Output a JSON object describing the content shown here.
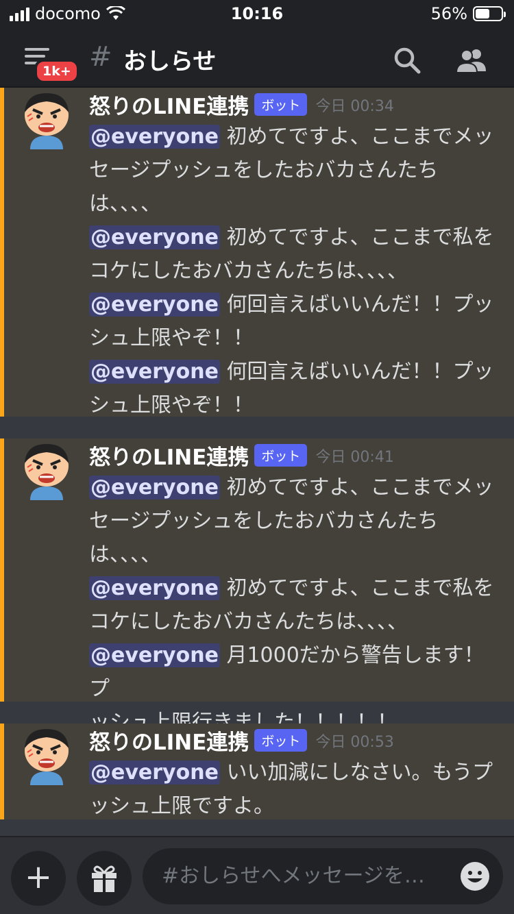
{
  "status_bar": {
    "carrier": "docomo",
    "time": "10:16",
    "battery": "56%",
    "battery_level": 0.56
  },
  "header": {
    "badge": "1k+",
    "channel_hash": "#",
    "channel_name": "おしらせ"
  },
  "messages": [
    {
      "author": "怒りのLINE連携",
      "bot_tag": "ボット",
      "timestamp": "今日 00:34",
      "lines": [
        {
          "mention": "@everyone",
          "text": " 初めてですよ、ここまでメッ"
        },
        {
          "mention": "",
          "text": "セージプッシュをしたおバカさんたち"
        },
        {
          "mention": "",
          "text": "は、、、、"
        },
        {
          "mention": "@everyone",
          "text": " 初めてですよ、ここまで私を"
        },
        {
          "mention": "",
          "text": "コケにしたおバカさんたちは、、、、"
        },
        {
          "mention": "@everyone",
          "text": " 何回言えばいいんだ！！プッ"
        },
        {
          "mention": "",
          "text": "シュ上限やぞ！！"
        },
        {
          "mention": "@everyone",
          "text": " 何回言えばいいんだ！！プッ"
        },
        {
          "mention": "",
          "text": "シュ上限やぞ！！"
        }
      ]
    },
    {
      "author": "怒りのLINE連携",
      "bot_tag": "ボット",
      "timestamp": "今日 00:41",
      "lines": [
        {
          "mention": "@everyone",
          "text": " 初めてですよ、ここまでメッ"
        },
        {
          "mention": "",
          "text": "セージプッシュをしたおバカさんたち"
        },
        {
          "mention": "",
          "text": "は、、、、"
        },
        {
          "mention": "@everyone",
          "text": " 初めてですよ、ここまで私を"
        },
        {
          "mention": "",
          "text": "コケにしたおバカさんたちは、、、、"
        },
        {
          "mention": "@everyone",
          "text": " 月1000だから警告します！プ"
        },
        {
          "mention": "",
          "text": "ッシュ上限行きました！！！！！"
        }
      ]
    },
    {
      "author": "怒りのLINE連携",
      "bot_tag": "ボット",
      "timestamp": "今日 00:53",
      "lines": [
        {
          "mention": "@everyone",
          "text": " いい加減にしなさい。もうプ"
        },
        {
          "mention": "",
          "text": "ッシュ上限ですよ。"
        }
      ]
    }
  ],
  "input": {
    "placeholder": "#おしらせへメッセージを…"
  },
  "colors": {
    "accent": "#faa61a",
    "bot_tag": "#5865f2",
    "mention_bg": "#3e4070",
    "badge": "#ed4245"
  }
}
